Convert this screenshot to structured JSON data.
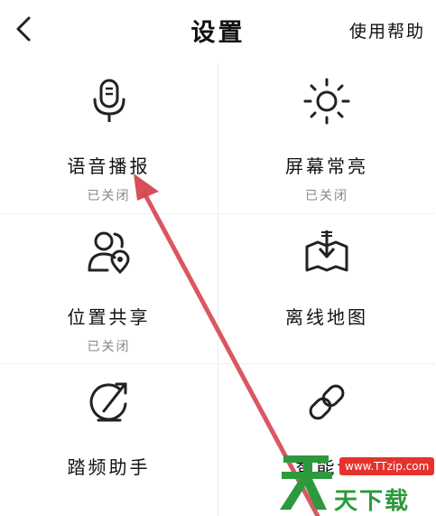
{
  "header": {
    "back_icon": "chevron-left-icon",
    "title": "设置",
    "help_label": "使用帮助"
  },
  "grid": [
    {
      "label": "语音播报",
      "status": "已关闭",
      "icon": "microphone-icon"
    },
    {
      "label": "屏幕常亮",
      "status": "已关闭",
      "icon": "sun-icon"
    },
    {
      "label": "位置共享",
      "status": "已关闭",
      "icon": "user-location-icon"
    },
    {
      "label": "离线地图",
      "status": "",
      "icon": "map-download-icon"
    },
    {
      "label": "踏频助手",
      "status": "",
      "icon": "cadence-icon"
    },
    {
      "label": "智能设",
      "status": "",
      "icon": "link-icon"
    }
  ],
  "watermark": {
    "url": "www.TTzip.com",
    "text": "天下载",
    "logo_color": "#2c9a3c",
    "badge_color": "#e5322d"
  },
  "annotation": {
    "arrow_color": "#d64550"
  }
}
